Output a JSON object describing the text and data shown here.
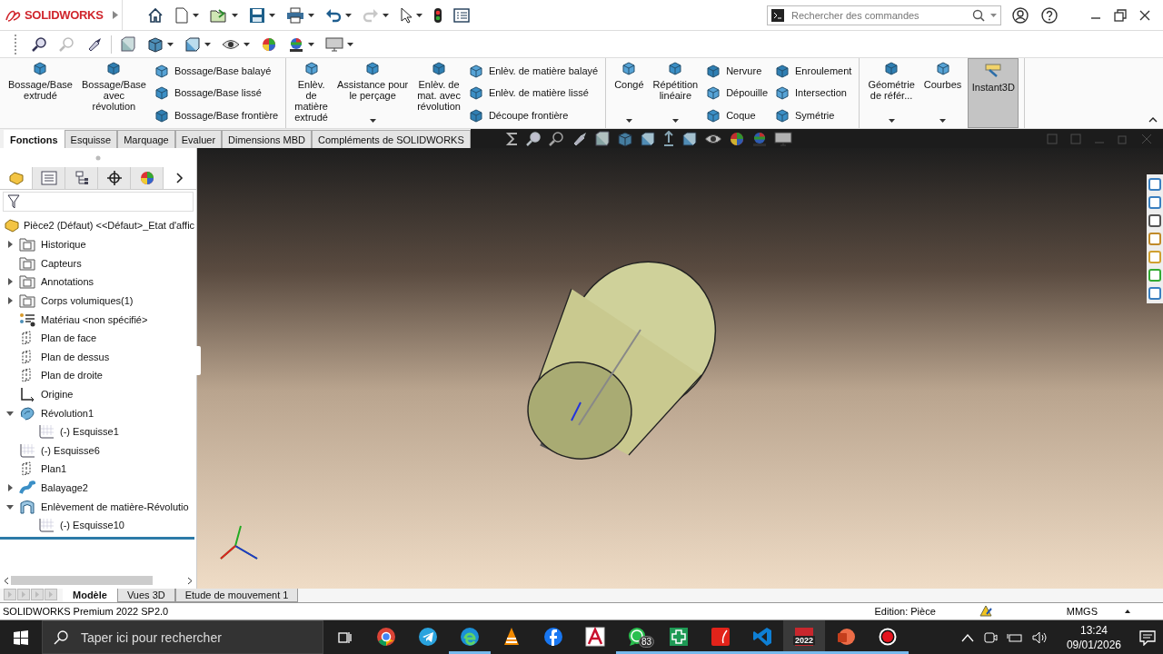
{
  "title_bar": {
    "logo": "SOLIDWORKS",
    "search": {
      "placeholder": "Rechercher des commandes"
    }
  },
  "ribbon": {
    "groups": [
      [
        {
          "kind": "large",
          "label": "Bossage/Base\nextrudé",
          "dropdown": false,
          "on": false
        },
        {
          "kind": "large",
          "label": "Bossage/Base\navec\nrévolution",
          "dropdown": false,
          "on": false
        },
        {
          "kind": "small",
          "items": [
            "Bossage/Base balayé",
            "Bossage/Base lissé",
            "Bossage/Base frontière"
          ]
        }
      ],
      [
        {
          "kind": "large",
          "label": "Enlèv.\nde\nmatière\nextrudé",
          "dropdown": false,
          "on": false
        },
        {
          "kind": "large",
          "label": "Assistance pour\nle perçage",
          "dropdown": true,
          "on": false
        },
        {
          "kind": "large",
          "label": "Enlèv. de\nmat. avec\nrévolution",
          "dropdown": false,
          "on": false
        },
        {
          "kind": "small",
          "items": [
            "Enlèv. de matière balayé",
            "Enlèv. de matière lissé",
            "Découpe frontière"
          ]
        }
      ],
      [
        {
          "kind": "large",
          "label": "Congé",
          "dropdown": true,
          "on": false
        },
        {
          "kind": "large",
          "label": "Répétition\nlinéaire",
          "dropdown": true,
          "on": false
        },
        {
          "kind": "small",
          "items": [
            "Nervure",
            "Dépouille",
            "Coque"
          ]
        },
        {
          "kind": "small",
          "items": [
            "Enroulement",
            "Intersection",
            "Symétrie"
          ]
        }
      ],
      [
        {
          "kind": "large",
          "label": "Géométrie\nde référ...",
          "dropdown": true,
          "on": false
        },
        {
          "kind": "large",
          "label": "Courbes",
          "dropdown": true,
          "on": false
        },
        {
          "kind": "large",
          "label": "Instant3D",
          "dropdown": false,
          "on": true
        }
      ]
    ]
  },
  "tabs": [
    {
      "label": "Fonctions",
      "selected": true
    },
    {
      "label": "Esquisse",
      "selected": false
    },
    {
      "label": "Marquage",
      "selected": false
    },
    {
      "label": "Evaluer",
      "selected": false
    },
    {
      "label": "Dimensions MBD",
      "selected": false
    },
    {
      "label": "Compléments de SOLIDWORKS",
      "selected": false
    }
  ],
  "tree": {
    "root": "Pièce2 (Défaut) <<Défaut>_Etat d'affic",
    "items": [
      {
        "label": "Historique",
        "kind": "folder",
        "expanded": false
      },
      {
        "label": "Capteurs",
        "kind": "folder"
      },
      {
        "label": "Annotations",
        "kind": "folder",
        "expanded": false
      },
      {
        "label": "Corps volumiques(1)",
        "kind": "folder",
        "expanded": false
      },
      {
        "label": "Matériau <non spécifié>",
        "kind": "material"
      },
      {
        "label": "Plan de face",
        "kind": "plane"
      },
      {
        "label": "Plan de dessus",
        "kind": "plane"
      },
      {
        "label": "Plan de droite",
        "kind": "plane"
      },
      {
        "label": "Origine",
        "kind": "origin"
      },
      {
        "label": "Révolution1",
        "kind": "revolve",
        "expanded": true,
        "children": [
          {
            "label": "(-) Esquisse1",
            "kind": "sketch"
          }
        ]
      },
      {
        "label": "(-) Esquisse6",
        "kind": "sketch"
      },
      {
        "label": "Plan1",
        "kind": "plane"
      },
      {
        "label": "Balayage2",
        "kind": "sweep",
        "expanded": false
      },
      {
        "label": "Enlèvement de matière-Révolutio",
        "kind": "cut",
        "expanded": true,
        "children": [
          {
            "label": "(-) Esquisse10",
            "kind": "sketch"
          }
        ]
      }
    ]
  },
  "bottom_tabs": [
    {
      "label": "Modèle",
      "selected": true
    },
    {
      "label": "Vues 3D",
      "selected": false
    },
    {
      "label": "Etude de mouvement 1",
      "selected": false
    }
  ],
  "status_bar": {
    "product": "SOLIDWORKS Premium 2022 SP2.0",
    "mode": "Edition: Pièce",
    "units": "MMGS"
  },
  "taskbar": {
    "search": {
      "placeholder": "Taper ici pour rechercher"
    },
    "apps": [
      {
        "kind": "chrome",
        "running": false,
        "active": false
      },
      {
        "kind": "telegram",
        "running": false,
        "active": false
      },
      {
        "kind": "edge",
        "running": true,
        "active": false
      },
      {
        "kind": "vlc",
        "running": false,
        "active": false
      },
      {
        "kind": "facebook",
        "running": false,
        "active": false
      },
      {
        "kind": "autocad",
        "running": false,
        "active": false
      },
      {
        "kind": "whatsapp",
        "running": true,
        "active": false,
        "badge": "83"
      },
      {
        "kind": "green",
        "running": true,
        "active": false
      },
      {
        "kind": "pdf",
        "running": true,
        "active": false
      },
      {
        "kind": "vscode",
        "running": true,
        "active": false
      },
      {
        "kind": "solidworks",
        "running": true,
        "active": true,
        "badge": "2022"
      },
      {
        "kind": "powerpoint",
        "running": true,
        "active": false
      },
      {
        "kind": "recorder",
        "running": true,
        "active": false
      }
    ],
    "clock": {
      "time": "13:24",
      "date": "09/01/2026"
    }
  }
}
